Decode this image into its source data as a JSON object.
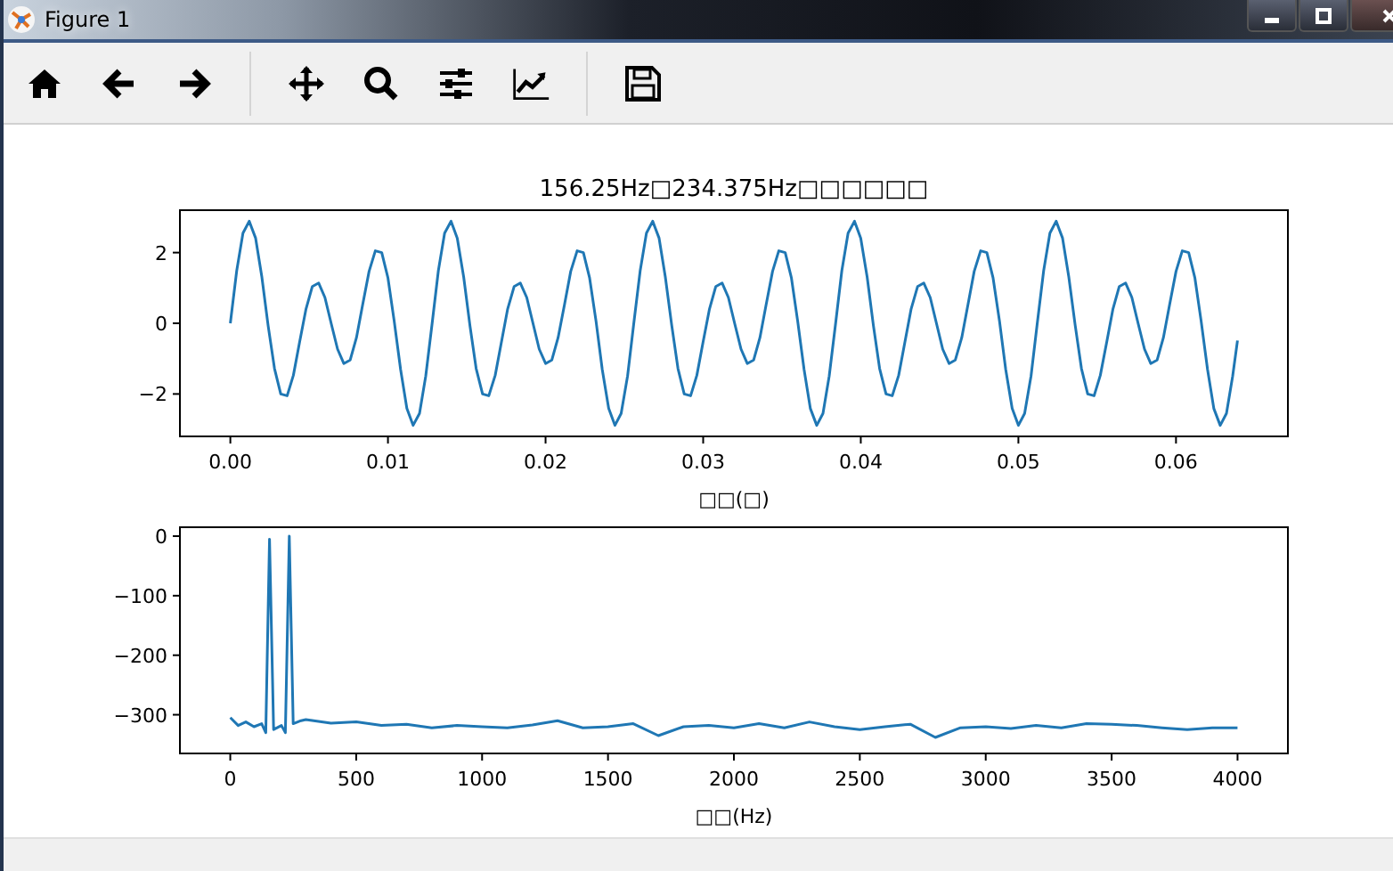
{
  "window": {
    "title": "Figure 1"
  },
  "figure": {
    "axes": [
      {
        "chart_data": {
          "type": "line",
          "title": "156.25Hz□234.375Hz□□□□□□",
          "xlabel": "□□(□)",
          "x": [
            0,
            0.0004,
            0.0008,
            0.0012,
            0.0016,
            0.002,
            0.0024,
            0.0028,
            0.0032,
            0.0036,
            0.004,
            0.0044,
            0.0048,
            0.0052,
            0.0056,
            0.006,
            0.0064,
            0.0068,
            0.0072,
            0.0076,
            0.008,
            0.0084,
            0.0088,
            0.0092,
            0.0096,
            0.01,
            0.0104,
            0.0108,
            0.0112,
            0.0116,
            0.012,
            0.0124,
            0.0128,
            0.0132,
            0.0136,
            0.014,
            0.0144,
            0.0148,
            0.0152,
            0.0156,
            0.016,
            0.0164,
            0.0168,
            0.0172,
            0.0176,
            0.018,
            0.0184,
            0.0188,
            0.0192,
            0.0196,
            0.02,
            0.0204,
            0.0208,
            0.0212,
            0.0216,
            0.022,
            0.0224,
            0.0228,
            0.0232,
            0.0236,
            0.024,
            0.0244,
            0.0248,
            0.0252,
            0.0256,
            0.026,
            0.0264,
            0.0268,
            0.0272,
            0.0276,
            0.028,
            0.0284,
            0.0288,
            0.0292,
            0.0296,
            0.03,
            0.0304,
            0.0308,
            0.0312,
            0.0316,
            0.032,
            0.0324,
            0.0328,
            0.0332,
            0.0336,
            0.034,
            0.0344,
            0.0348,
            0.0352,
            0.0356,
            0.036,
            0.0364,
            0.0368,
            0.0372,
            0.0376,
            0.038,
            0.0384,
            0.0388,
            0.0392,
            0.0396,
            0.04,
            0.0404,
            0.0408,
            0.0412,
            0.0416,
            0.042,
            0.0424,
            0.0428,
            0.0432,
            0.0436,
            0.044,
            0.0444,
            0.0448,
            0.0452,
            0.0456,
            0.046,
            0.0464,
            0.0468,
            0.0472,
            0.0476,
            0.048,
            0.0484,
            0.0488,
            0.0492,
            0.0496,
            0.05,
            0.0504,
            0.0508,
            0.0512,
            0.0516,
            0.052,
            0.0524,
            0.0528,
            0.0532,
            0.0536,
            0.054,
            0.0544,
            0.0548,
            0.0552,
            0.0556,
            0.056,
            0.0564,
            0.0568,
            0.0572,
            0.0576,
            0.058,
            0.0584,
            0.0588,
            0.0592,
            0.0596,
            0.06,
            0.0604,
            0.0608,
            0.0612,
            0.0616,
            0.062,
            0.0624,
            0.0628,
            0.0632,
            0.0636,
            0.0639
          ],
          "series": [
            {
              "color": "#1f77b4",
              "values": [
                0,
                1.49,
                2.55,
                2.89,
                2.41,
                1.31,
                -0.06,
                -1.28,
                -2,
                -2.05,
                -1.47,
                -0.53,
                0.41,
                1.04,
                1.14,
                0.73,
                0,
                -0.73,
                -1.14,
                -1.04,
                -0.41,
                0.53,
                1.47,
                2.05,
                2,
                1.28,
                0.06,
                -1.31,
                -2.41,
                -2.89,
                -2.55,
                -1.49,
                0,
                1.49,
                2.55,
                2.89,
                2.41,
                1.31,
                -0.06,
                -1.28,
                -2,
                -2.05,
                -1.47,
                -0.53,
                0.41,
                1.04,
                1.14,
                0.73,
                0,
                -0.73,
                -1.14,
                -1.04,
                -0.41,
                0.53,
                1.47,
                2.05,
                2,
                1.28,
                0.06,
                -1.31,
                -2.41,
                -2.89,
                -2.55,
                -1.49,
                0,
                1.49,
                2.55,
                2.89,
                2.41,
                1.31,
                -0.06,
                -1.28,
                -2,
                -2.05,
                -1.47,
                -0.53,
                0.41,
                1.04,
                1.14,
                0.73,
                0,
                -0.73,
                -1.14,
                -1.04,
                -0.41,
                0.53,
                1.47,
                2.05,
                2,
                1.28,
                0.06,
                -1.31,
                -2.41,
                -2.89,
                -2.55,
                -1.49,
                0,
                1.49,
                2.55,
                2.89,
                2.41,
                1.31,
                -0.06,
                -1.28,
                -2,
                -2.05,
                -1.47,
                -0.53,
                0.41,
                1.04,
                1.14,
                0.73,
                0,
                -0.73,
                -1.14,
                -1.04,
                -0.41,
                0.53,
                1.47,
                2.05,
                2,
                1.28,
                0.06,
                -1.31,
                -2.41,
                -2.89,
                -2.55,
                -1.49,
                0,
                1.49,
                2.55,
                2.89,
                2.41,
                1.31,
                -0.06,
                -1.28,
                -2,
                -2.05,
                -1.47,
                -0.53,
                0.41,
                1.04,
                1.14,
                0.73,
                0,
                -0.73,
                -1.14,
                -1.04,
                -0.41,
                0.53,
                1.47,
                2.05,
                2,
                1.28,
                0.06,
                -1.31,
                -2.41,
                -2.89,
                -2.55,
                -1.49,
                -0.49
              ]
            }
          ],
          "xlim": [
            -0.0032,
            0.0671
          ],
          "ylim": [
            -3.2,
            3.2
          ],
          "xticks": [
            {
              "value": 0,
              "label": "0.00"
            },
            {
              "value": 0.01,
              "label": "0.01"
            },
            {
              "value": 0.02,
              "label": "0.02"
            },
            {
              "value": 0.03,
              "label": "0.03"
            },
            {
              "value": 0.04,
              "label": "0.04"
            },
            {
              "value": 0.05,
              "label": "0.05"
            },
            {
              "value": 0.06,
              "label": "0.06"
            }
          ],
          "yticks": [
            {
              "value": -2,
              "label": "−2"
            },
            {
              "value": 0,
              "label": "0"
            },
            {
              "value": 2,
              "label": "2"
            }
          ]
        }
      },
      {
        "chart_data": {
          "type": "line",
          "xlabel": "□□(Hz)",
          "x": [
            0,
            31,
            62,
            94,
            125,
            141,
            156,
            172,
            203,
            219,
            234,
            250,
            281,
            300,
            400,
            500,
            600,
            700,
            800,
            900,
            1000,
            1100,
            1200,
            1300,
            1400,
            1500,
            1600,
            1700,
            1800,
            1900,
            2000,
            2100,
            2200,
            2300,
            2400,
            2500,
            2600,
            2700,
            2800,
            2900,
            3000,
            3100,
            3200,
            3300,
            3400,
            3500,
            3600,
            3700,
            3800,
            3900,
            4000
          ],
          "series": [
            {
              "color": "#1f77b4",
              "values": [
                -305,
                -318,
                -312,
                -320,
                -315,
                -330,
                -5,
                -325,
                -318,
                -330,
                0,
                -315,
                -310,
                -308,
                -314,
                -312,
                -318,
                -316,
                -322,
                -318,
                -320,
                -322,
                -317,
                -310,
                -322,
                -320,
                -315,
                -335,
                -320,
                -318,
                -322,
                -315,
                -322,
                -312,
                -320,
                -325,
                -320,
                -316,
                -338,
                -322,
                -320,
                -323,
                -318,
                -322,
                -315,
                -316,
                -318,
                -322,
                -325,
                -322,
                -322
              ]
            }
          ],
          "xlim": [
            -200,
            4200
          ],
          "ylim": [
            -365,
            15
          ],
          "xticks": [
            0,
            500,
            1000,
            1500,
            2000,
            2500,
            3000,
            3500,
            4000
          ],
          "yticks": [
            {
              "value": 0,
              "label": "0"
            },
            {
              "value": -100,
              "label": "−100"
            },
            {
              "value": -200,
              "label": "−200"
            },
            {
              "value": -300,
              "label": "−300"
            }
          ]
        }
      }
    ]
  }
}
